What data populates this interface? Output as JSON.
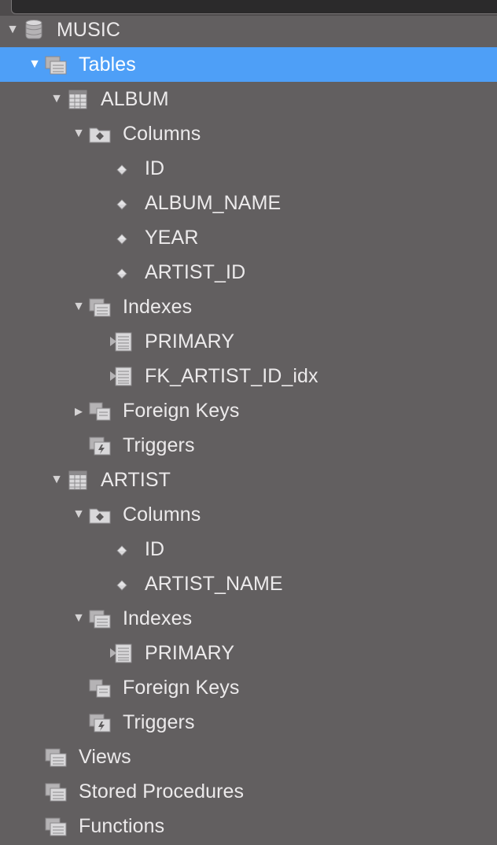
{
  "tree": [
    {
      "id": "music",
      "label": "MUSIC",
      "level": 0,
      "icon": "database-icon",
      "expanded": true
    },
    {
      "id": "tables",
      "label": "Tables",
      "level": 1,
      "icon": "tables-folder-icon",
      "expanded": true,
      "selected": true
    },
    {
      "id": "album",
      "label": "ALBUM",
      "level": 2,
      "icon": "table-icon",
      "expanded": true
    },
    {
      "id": "album-columns",
      "label": "Columns",
      "level": 3,
      "icon": "columns-folder-icon",
      "expanded": true
    },
    {
      "id": "album-col-id",
      "label": "ID",
      "level": 4,
      "icon": "column-diamond-icon"
    },
    {
      "id": "album-col-album-name",
      "label": "ALBUM_NAME",
      "level": 4,
      "icon": "column-diamond-icon"
    },
    {
      "id": "album-col-year",
      "label": "YEAR",
      "level": 4,
      "icon": "column-diamond-icon"
    },
    {
      "id": "album-col-artist-id",
      "label": "ARTIST_ID",
      "level": 4,
      "icon": "column-diamond-icon"
    },
    {
      "id": "album-indexes",
      "label": "Indexes",
      "level": 3,
      "icon": "indexes-folder-icon",
      "expanded": true
    },
    {
      "id": "album-idx-primary",
      "label": "PRIMARY",
      "level": 4,
      "icon": "index-icon"
    },
    {
      "id": "album-idx-fk-artist",
      "label": "FK_ARTIST_ID_idx",
      "level": 4,
      "icon": "index-icon"
    },
    {
      "id": "album-foreign-keys",
      "label": "Foreign Keys",
      "level": 3,
      "icon": "foreign-keys-folder-icon",
      "expanded": false
    },
    {
      "id": "album-triggers",
      "label": "Triggers",
      "level": 3,
      "icon": "triggers-folder-icon"
    },
    {
      "id": "artist",
      "label": "ARTIST",
      "level": 2,
      "icon": "table-icon",
      "expanded": true
    },
    {
      "id": "artist-columns",
      "label": "Columns",
      "level": 3,
      "icon": "columns-folder-icon",
      "expanded": true
    },
    {
      "id": "artist-col-id",
      "label": "ID",
      "level": 4,
      "icon": "column-diamond-icon"
    },
    {
      "id": "artist-col-artist-name",
      "label": "ARTIST_NAME",
      "level": 4,
      "icon": "column-diamond-icon"
    },
    {
      "id": "artist-indexes",
      "label": "Indexes",
      "level": 3,
      "icon": "indexes-folder-icon",
      "expanded": true
    },
    {
      "id": "artist-idx-primary",
      "label": "PRIMARY",
      "level": 4,
      "icon": "index-icon"
    },
    {
      "id": "artist-foreign-keys",
      "label": "Foreign Keys",
      "level": 3,
      "icon": "foreign-keys-folder-icon"
    },
    {
      "id": "artist-triggers",
      "label": "Triggers",
      "level": 3,
      "icon": "triggers-folder-icon"
    },
    {
      "id": "views",
      "label": "Views",
      "level": 1,
      "icon": "views-folder-icon"
    },
    {
      "id": "stored-procedures",
      "label": "Stored Procedures",
      "level": 1,
      "icon": "procedures-folder-icon"
    },
    {
      "id": "functions",
      "label": "Functions",
      "level": 1,
      "icon": "functions-folder-icon"
    }
  ],
  "colors": {
    "background": "#625f60",
    "selection": "#4e9ff7",
    "text": "#eceaeb",
    "icon_light": "#d9d8da",
    "icon_dark": "#8c8a8c"
  }
}
